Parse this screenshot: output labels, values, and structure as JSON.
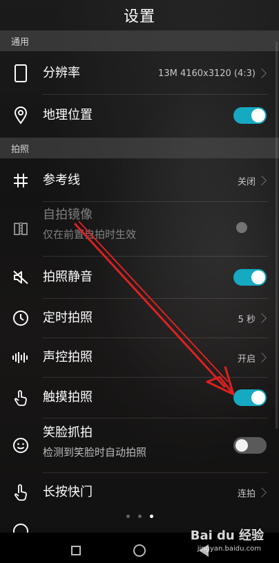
{
  "header": {
    "title": "设置"
  },
  "sections": {
    "general": "通用",
    "photo": "拍照"
  },
  "rows": {
    "resolution": {
      "label": "分辨率",
      "value": "13M 4160x3120 (4:3)"
    },
    "location": {
      "label": "地理位置",
      "state": "on"
    },
    "gridlines": {
      "label": "参考线",
      "value": "关闭"
    },
    "mirror": {
      "label": "自拍镜像",
      "sub": "仅在前置自拍时生效",
      "state": "disabled"
    },
    "mute": {
      "label": "拍照静音",
      "state": "on"
    },
    "timer": {
      "label": "定时拍照",
      "value": "5 秒"
    },
    "voice": {
      "label": "声控拍照",
      "value": "开启"
    },
    "touch": {
      "label": "触摸拍照",
      "state": "on"
    },
    "smile": {
      "label": "笑脸抓拍",
      "sub": "检测到笑脸时自动拍照",
      "state": "off"
    },
    "longpress": {
      "label": "长按快门",
      "value": "连拍"
    }
  },
  "page_indicator": {
    "count": 3,
    "active": 3
  },
  "watermark": {
    "brand": "Bai du 经验",
    "url": "jingyan.baidu.com"
  },
  "colors": {
    "accent": "#15a9c2",
    "annotation_arrow": "#e02020"
  }
}
